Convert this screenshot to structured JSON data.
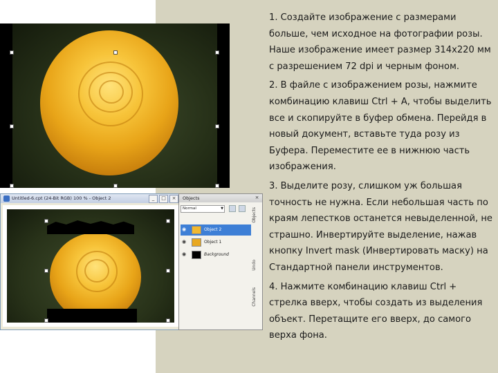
{
  "instructions": [
    "1. Создайте изображение с размерами больше, чем исходное на фотографии розы. Наше изображение имеет размер 314х220 мм с разрешением 72 dpi и черным фоном.",
    "2. В файле с изображением розы, нажмите комбинацию клавиш Ctrl + A, чтобы выделить все и скопируйте в буфер обмена. Перейдя в новый документ, вставьте туда розу из Буфера. Переместите ее в нижнюю часть изображения.",
    "3. Выделите розу, слишком уж большая точность не нужна. Если небольшая часть по краям лепестков останется невыделенной, не страшно. Инвертируйте выделение, нажав кнопку Invert mask (Инвертировать маску) на Стандартной панели инструментов.",
    "4. Нажмите комбинацию клавиш Ctrl + стрелка вверх, чтобы создать из выделения объект. Перетащите его вверх, до самого верха фона."
  ],
  "app_window": {
    "title": "Untitled-6.cpt (24-Bit RGB) 100 % - Object 2",
    "buttons": [
      "_",
      "□",
      "×"
    ]
  },
  "objects_panel": {
    "title": "Objects",
    "close": "×",
    "mode": "Normal",
    "layers": [
      {
        "label": "Object 2",
        "selected": true
      },
      {
        "label": "Object 1",
        "selected": false
      },
      {
        "label": "Background",
        "selected": false
      }
    ],
    "side_tabs": [
      "Objects",
      "Undo",
      "Channels"
    ]
  },
  "colors": {
    "panel_bg": "#d6d3bf",
    "rose": "#f7c43a",
    "selection": "#3d7fd6"
  }
}
